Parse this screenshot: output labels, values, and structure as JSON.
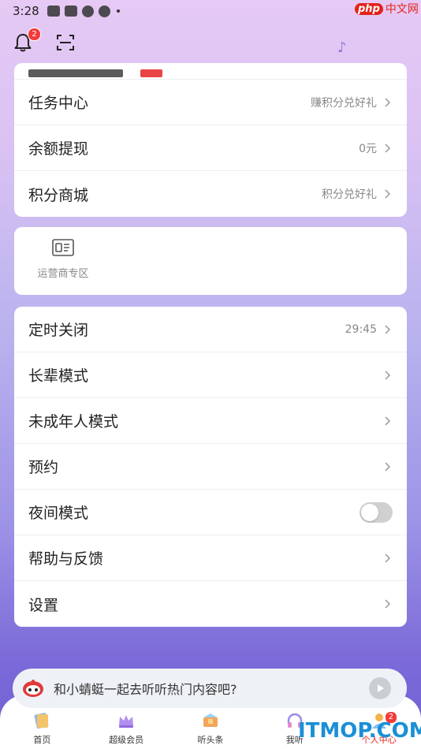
{
  "status": {
    "time": "3:28"
  },
  "watermark": {
    "php": "php",
    "cn": "中文网",
    "itmop": "ITMOP.COM"
  },
  "topbar": {
    "notif_count": "2"
  },
  "card1": {
    "rows": [
      {
        "label": "任务中心",
        "value": "赚积分兑好礼"
      },
      {
        "label": "余额提现",
        "value": "0元"
      },
      {
        "label": "积分商城",
        "value": "积分兑好礼"
      }
    ]
  },
  "operator": {
    "label": "运营商专区"
  },
  "settings": {
    "rows": [
      {
        "label": "定时关闭",
        "value": "29:45"
      },
      {
        "label": "长辈模式",
        "value": ""
      },
      {
        "label": "未成年人模式",
        "value": ""
      },
      {
        "label": "预约",
        "value": ""
      },
      {
        "label": "夜间模式",
        "value": ""
      },
      {
        "label": "帮助与反馈",
        "value": ""
      },
      {
        "label": "设置",
        "value": ""
      }
    ]
  },
  "prompt": {
    "text": "和小蜻蜓一起去听听热门内容吧?"
  },
  "tabs": [
    {
      "label": "首页"
    },
    {
      "label": "超级会员"
    },
    {
      "label": "听头条"
    },
    {
      "label": "我听"
    },
    {
      "label": "个人中心",
      "badge": "2"
    }
  ],
  "colors": {
    "accent": "#e2231a",
    "toggle_off": "#d0d0d0"
  }
}
